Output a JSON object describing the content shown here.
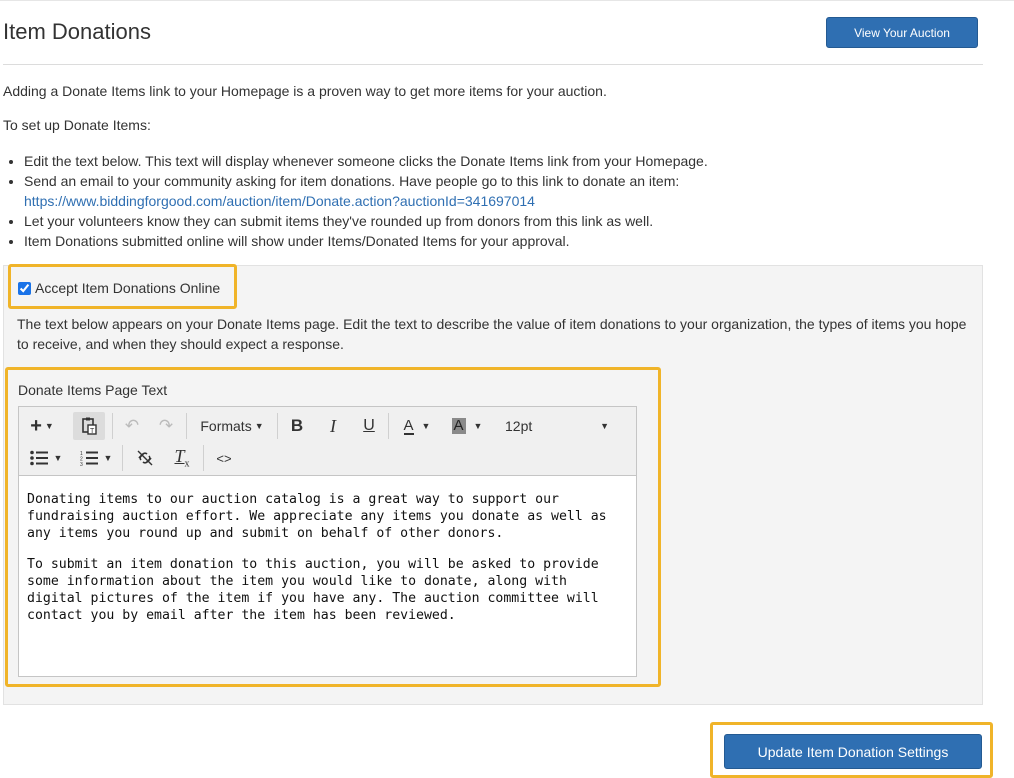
{
  "header": {
    "title": "Item Donations",
    "view_auction_label": "View Your Auction"
  },
  "intro": {
    "paragraph1": "Adding a Donate Items link to your Homepage is a proven way to get more items for your auction.",
    "paragraph2": "To set up Donate Items:",
    "bullets": [
      "Edit the text below. This text will display whenever someone clicks the Donate Items link from your Homepage.",
      "Send an email to your community asking for item donations. Have people go to this link to donate an item:",
      "Let your volunteers know they can submit items they've rounded up from donors from this link as well.",
      "Item Donations submitted online will show under Items/Donated Items for your approval."
    ],
    "donate_link": "https://www.biddingforgood.com/auction/item/Donate.action?auctionId=341697014"
  },
  "settings": {
    "accept_label": "Accept Item Donations Online",
    "accept_checked": true,
    "description": "The text below appears on your Donate Items page. Edit the text to describe the value of item donations to your organization, the types of items you hope to receive, and when they should expect a response.",
    "editor_label": "Donate Items Page Text"
  },
  "toolbar": {
    "formats_label": "Formats",
    "bold": "B",
    "italic": "I",
    "underline": "U",
    "text_color": "A",
    "bg_color": "A",
    "font_size": "12pt",
    "code": "<>"
  },
  "editor_content": {
    "paragraph1": "Donating items to our auction catalog is a great way to support our fundraising auction effort. We appreciate any items you donate as well as any items you round up and submit on behalf of other donors.",
    "paragraph2": "To submit an item donation to this auction, you will be asked to provide some information about the item you would like to donate, along with digital pictures of the item if you have any. The auction committee will contact you by email after the item has been reviewed."
  },
  "footer": {
    "update_label": "Update Item Donation Settings"
  },
  "colors": {
    "primary_button": "#2f6fb2",
    "highlight": "#f0b429",
    "link": "#2f6fb2"
  }
}
